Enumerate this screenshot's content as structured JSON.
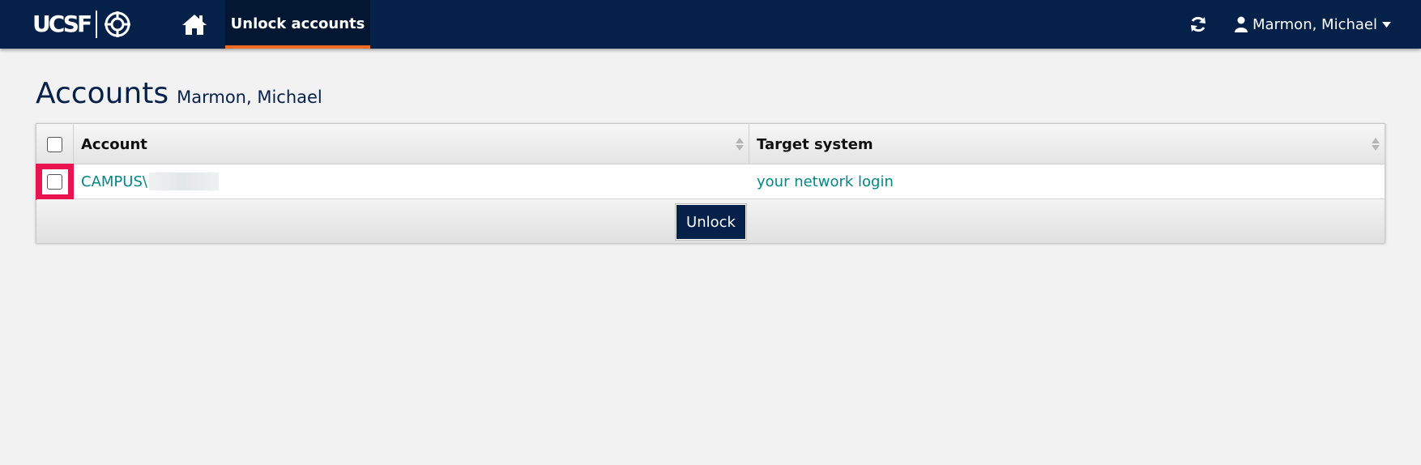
{
  "navbar": {
    "logo_text": "UCSF",
    "tab_label": "Unlock accounts",
    "user_name": "Marmon, Michael"
  },
  "page": {
    "title": "Accounts",
    "subtitle": "Marmon, Michael"
  },
  "table": {
    "columns": [
      "Account",
      "Target system"
    ],
    "rows": [
      {
        "account": "CAMPUS\\",
        "target_system": "your network login",
        "checked": false
      }
    ],
    "unlock_label": "Unlock"
  },
  "colors": {
    "navy": "#052049",
    "accent_orange": "#f26d21",
    "link_teal": "#058585",
    "highlight_red": "#e8134f"
  }
}
